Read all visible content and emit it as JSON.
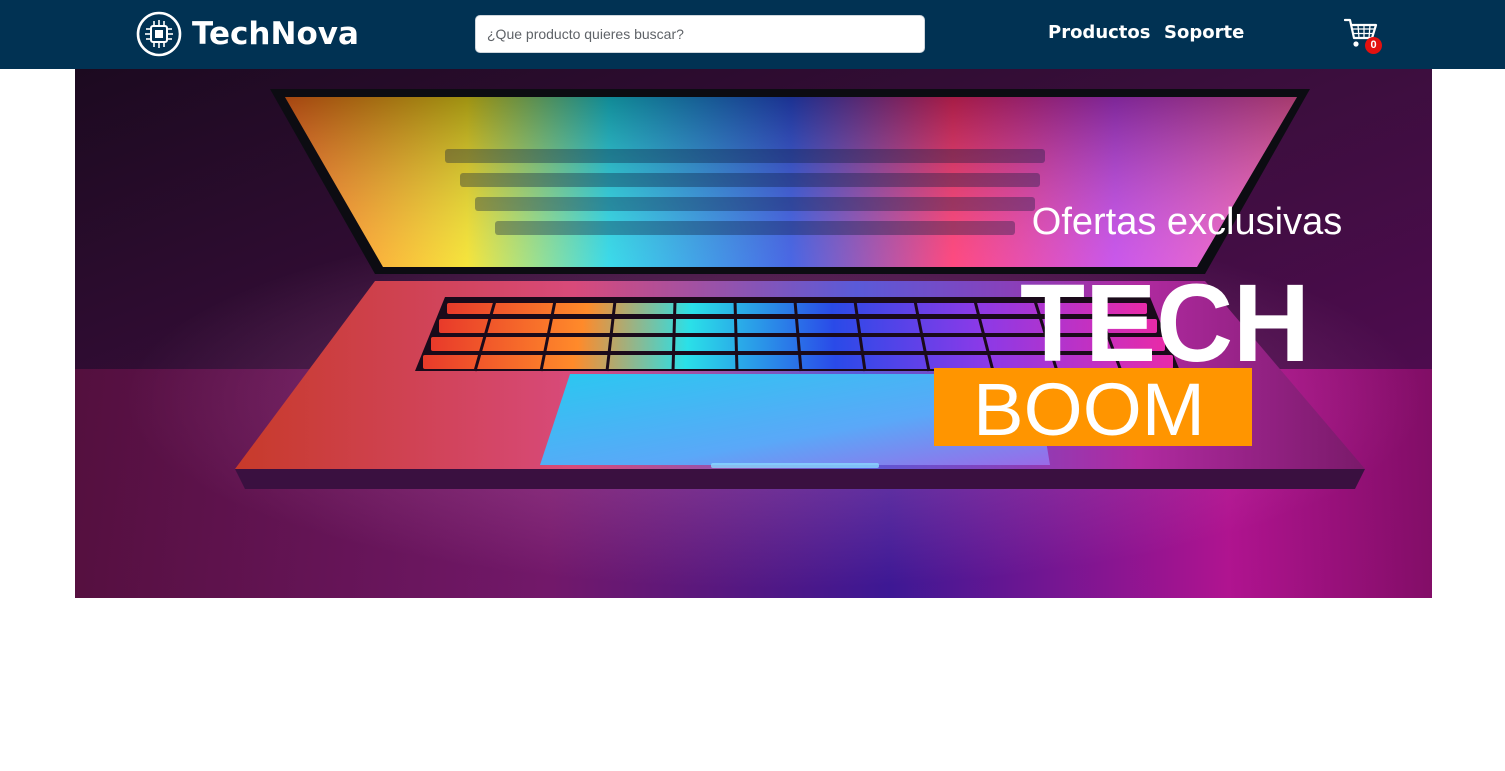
{
  "header": {
    "brand_name": "TechNova",
    "logo_icon": "circuit-chip-icon",
    "search_placeholder": "¿Que producto quieres buscar?",
    "nav": {
      "productos": "Productos",
      "soporte": "Soporte"
    },
    "cart_icon": "shopping-cart-icon",
    "cart_count": "0",
    "background_color": "#013253",
    "badge_color": "#e3110f"
  },
  "banner": {
    "image_icon": "laptop-keyboard-image",
    "subtitle": "Ofertas exclusivas",
    "title_line1": "TECH",
    "title_line2": "BOOM",
    "accent_color": "#ff9500"
  }
}
